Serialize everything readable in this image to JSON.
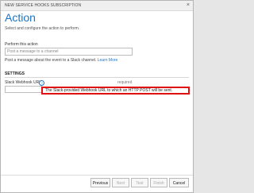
{
  "dialog": {
    "title": "NEW SERVICE HOOKS SUBSCRIPTION",
    "close_glyph": "×"
  },
  "page": {
    "heading": "Action",
    "subheading": "Select and configure the action to perform."
  },
  "perform": {
    "label": "Perform this action",
    "selected": "Post a message to a channel"
  },
  "description": {
    "text": "Post a message about the event to a Slack channel.",
    "link": "Learn More"
  },
  "settings": {
    "title": "SETTINGS",
    "webhook_label": "Slack Webhook URL",
    "help_glyph": "?",
    "required": "required",
    "webhook_value": "",
    "tooltip": "The Slack-provided Webhook URL to which an HTTP POST will be sent."
  },
  "footer": {
    "previous": "Previous",
    "next": "Next",
    "test": "Test",
    "finish": "Finish",
    "cancel": "Cancel"
  },
  "colors": {
    "accent": "#1a74c6",
    "highlight": "#e01010"
  }
}
